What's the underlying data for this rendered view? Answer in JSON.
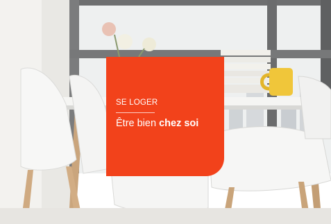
{
  "hero": {
    "eyebrow": "SE LOGER",
    "headline_regular": "Être bien ",
    "headline_bold": "chez soi"
  },
  "colors": {
    "accent": "#f2421b",
    "text_on_accent": "#ffffff"
  }
}
